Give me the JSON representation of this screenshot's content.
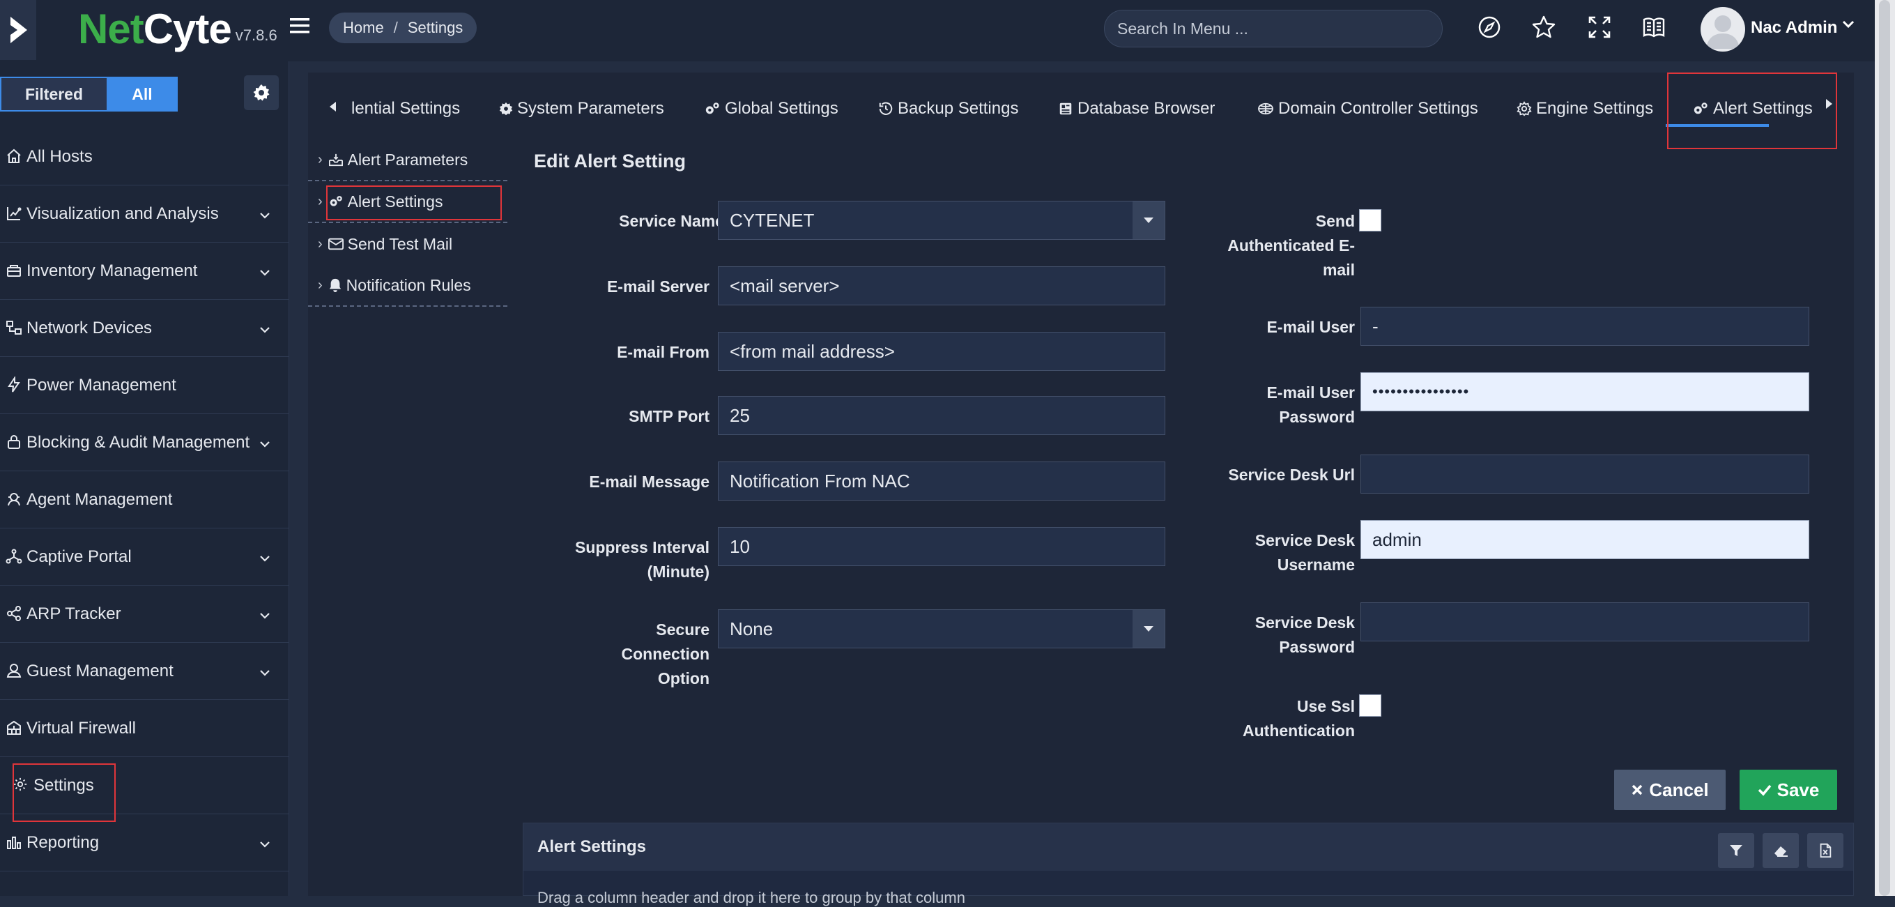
{
  "brand": {
    "name_part1": "Net",
    "name_part2": "Cyte",
    "version": "v7.8.6"
  },
  "breadcrumb": {
    "home": "Home",
    "separator": "/",
    "current": "Settings"
  },
  "search": {
    "placeholder": "Search In Menu ..."
  },
  "user": {
    "name": "Nac Admin"
  },
  "sidebar": {
    "filter_filtered": "Filtered",
    "filter_all": "All",
    "items": [
      {
        "label": "All Hosts",
        "icon": "home-icon",
        "has_chevron": false
      },
      {
        "label": "Visualization and Analysis",
        "icon": "chart-icon",
        "has_chevron": true
      },
      {
        "label": "Inventory Management",
        "icon": "inventory-icon",
        "has_chevron": true
      },
      {
        "label": "Network Devices",
        "icon": "network-devices-icon",
        "has_chevron": true
      },
      {
        "label": "Power Management",
        "icon": "bolt-icon",
        "has_chevron": false
      },
      {
        "label": "Blocking & Audit Management",
        "icon": "lock-icon",
        "has_chevron": true
      },
      {
        "label": "Agent Management",
        "icon": "agent-icon",
        "has_chevron": false
      },
      {
        "label": "Captive Portal",
        "icon": "captive-portal-icon",
        "has_chevron": true
      },
      {
        "label": "ARP Tracker",
        "icon": "share-icon",
        "has_chevron": true
      },
      {
        "label": "Guest Management",
        "icon": "guest-icon",
        "has_chevron": true
      },
      {
        "label": "Virtual Firewall",
        "icon": "firewall-icon",
        "has_chevron": false
      },
      {
        "label": "Settings",
        "icon": "gear-icon",
        "has_chevron": false
      },
      {
        "label": "Reporting",
        "icon": "report-icon",
        "has_chevron": true
      }
    ]
  },
  "tabs": [
    {
      "label": "lential Settings",
      "icon": ""
    },
    {
      "label": "System Parameters",
      "icon": "gear-icon"
    },
    {
      "label": "Global Settings",
      "icon": "gears-icon"
    },
    {
      "label": "Backup Settings",
      "icon": "history-icon"
    },
    {
      "label": "Database Browser",
      "icon": "database-icon"
    },
    {
      "label": "Domain Controller Settings",
      "icon": "domain-icon"
    },
    {
      "label": "Engine Settings",
      "icon": "gear-outline-icon"
    },
    {
      "label": "Alert Settings",
      "icon": "gears-icon"
    }
  ],
  "subnav": [
    {
      "label": "Alert Parameters",
      "icon": "inbox-icon"
    },
    {
      "label": "Alert Settings",
      "icon": "gears-icon"
    },
    {
      "label": "Send Test Mail",
      "icon": "mail-icon"
    },
    {
      "label": "Notification Rules",
      "icon": "bell-icon"
    }
  ],
  "form": {
    "title": "Edit Alert Setting",
    "service_name_label": "Service Name",
    "service_name_required": "*",
    "service_name_value": "CYTENET",
    "email_server_label": "E-mail Server",
    "email_server_value": "<mail server>",
    "email_from_label": "E-mail From",
    "email_from_value": "<from mail address>",
    "smtp_port_label": "SMTP Port",
    "smtp_port_value": "25",
    "email_message_label": "E-mail Message",
    "email_message_value": "Notification From NAC",
    "suppress_label_1": "Suppress Interval",
    "suppress_label_2": "(Minute)",
    "suppress_value": "10",
    "secure_label_1": "Secure",
    "secure_label_2": "Connection",
    "secure_label_3": "Option",
    "secure_value": "None",
    "send_auth_label_1": "Send",
    "send_auth_label_2": "Authenticated E-",
    "send_auth_label_3": "mail",
    "email_user_label": "E-mail User",
    "email_user_value": "-",
    "email_pass_label_1": "E-mail User",
    "email_pass_label_2": "Password",
    "email_pass_value": "••••••••••••••••",
    "sd_url_label": "Service Desk Url",
    "sd_url_value": "",
    "sd_user_label_1": "Service Desk",
    "sd_user_label_2": "Username",
    "sd_user_value": "admin",
    "sd_pass_label_1": "Service Desk",
    "sd_pass_label_2": "Password",
    "sd_pass_value": "",
    "use_ssl_label_1": "Use Ssl",
    "use_ssl_label_2": "Authentication"
  },
  "actions": {
    "cancel": "Cancel",
    "save": "Save"
  },
  "grid": {
    "title": "Alert Settings",
    "group_hint": "Drag a column header and drop it here to group by that column"
  },
  "colors": {
    "accent": "#3d8be8",
    "save": "#21a45a",
    "highlight": "#e0353a",
    "brand_green": "#3cae4a"
  }
}
